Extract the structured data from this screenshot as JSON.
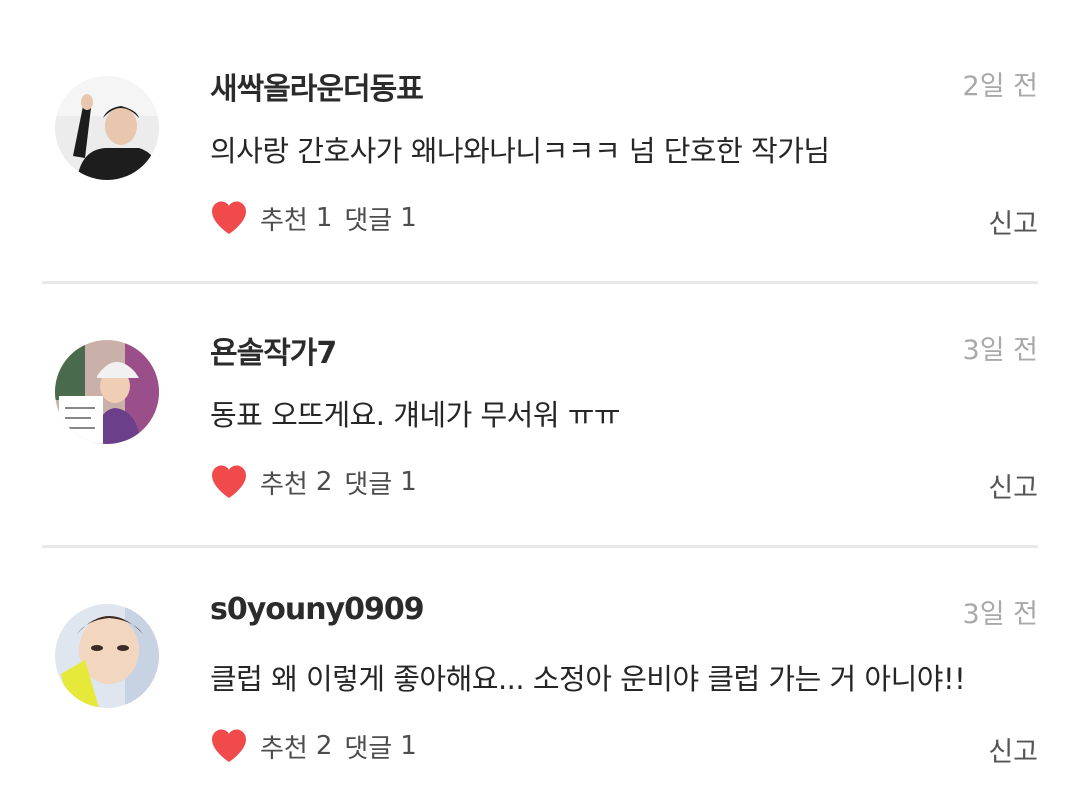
{
  "comments": [
    {
      "username": "새싹올라운더동표",
      "time": "2일 전",
      "text": "의사랑 간호사가 왜나와나니ㅋㅋㅋ 넘 단호한 작가님",
      "like_label": "추천",
      "like_count": "1",
      "reply_label": "댓글",
      "reply_count": "1",
      "report_label": "신고"
    },
    {
      "username": "욘솔작가7",
      "time": "3일 전",
      "text": "동표 오뜨게요. 걔네가 무서워 ㅠㅠ",
      "like_label": "추천",
      "like_count": "2",
      "reply_label": "댓글",
      "reply_count": "1",
      "report_label": "신고"
    },
    {
      "username": "s0youny0909",
      "time": "3일 전",
      "text": "클럽 왜 이렇게 좋아해요... 소정아 운비야 클럽 가는 거 아니야!!",
      "like_label": "추천",
      "like_count": "2",
      "reply_label": "댓글",
      "reply_count": "1",
      "report_label": "신고"
    }
  ],
  "colors": {
    "heart": "#f04a4a",
    "divider": "#e8e8e8",
    "time": "#a9a9a9"
  },
  "icons": {
    "like": "heart-icon",
    "avatar": "user-avatar"
  }
}
